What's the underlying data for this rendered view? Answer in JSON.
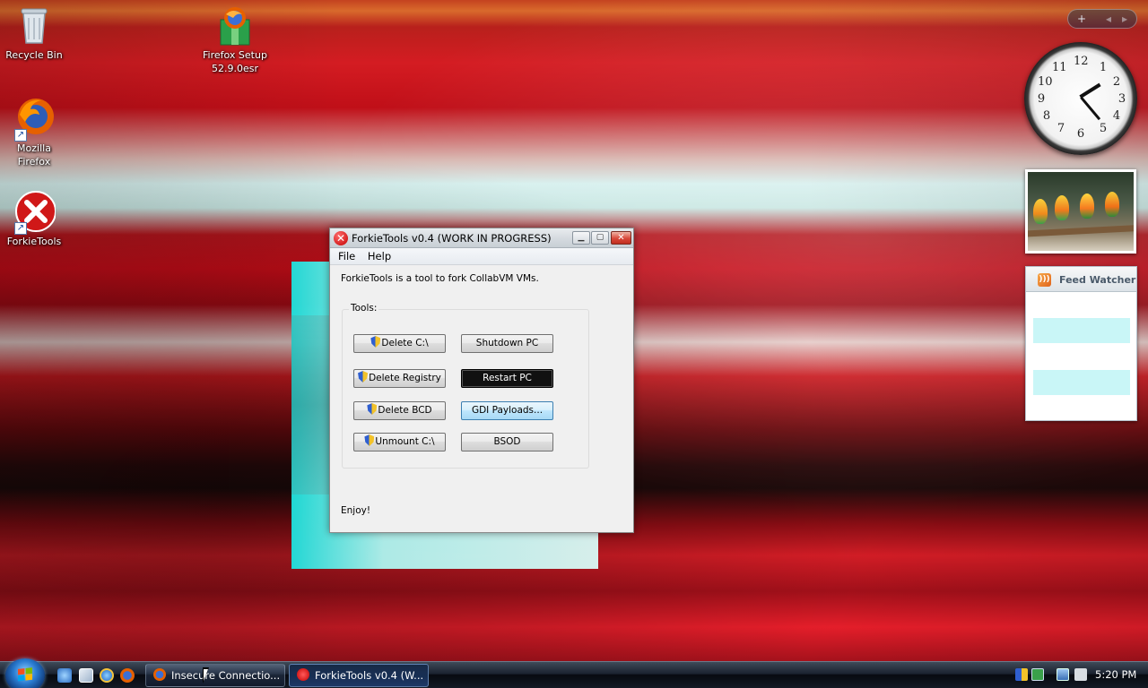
{
  "desktop": {
    "icons": [
      {
        "label": "Recycle Bin"
      },
      {
        "label": "Firefox Setup 52.9.0esr"
      },
      {
        "label": "Mozilla Firefox"
      },
      {
        "label": "ForkieTools"
      }
    ]
  },
  "window": {
    "title": "ForkieTools v0.4 (WORK IN PROGRESS)",
    "menu": [
      "File",
      "Help"
    ],
    "description": "ForkieTools is a tool to fork CollabVM VMs.",
    "group_label": "Tools:",
    "buttons": {
      "delete_c": "Delete C:\\",
      "shutdown": "Shutdown PC",
      "delete_registry": "Delete Registry",
      "restart": "Restart PC",
      "delete_bcd": "Delete BCD",
      "gdi_payloads": "GDI Payloads...",
      "unmount_c": "Unmount C:\\",
      "bsod": "BSOD"
    },
    "footer": "Enjoy!"
  },
  "sidebar": {
    "feed_title": "Feed Watcher",
    "clock_numbers": [
      "12",
      "1",
      "2",
      "3",
      "4",
      "5",
      "6",
      "7",
      "8",
      "9",
      "10",
      "11"
    ]
  },
  "taskbar": {
    "tasks": [
      {
        "label": "Insecure Connectio..."
      },
      {
        "label": "ForkieTools v0.4 (W..."
      }
    ],
    "time": "5:20 PM"
  },
  "colors": {
    "accent_close": "#c12e20",
    "taskbar": "#131924",
    "cyan_panel": "#1fe0dc"
  }
}
